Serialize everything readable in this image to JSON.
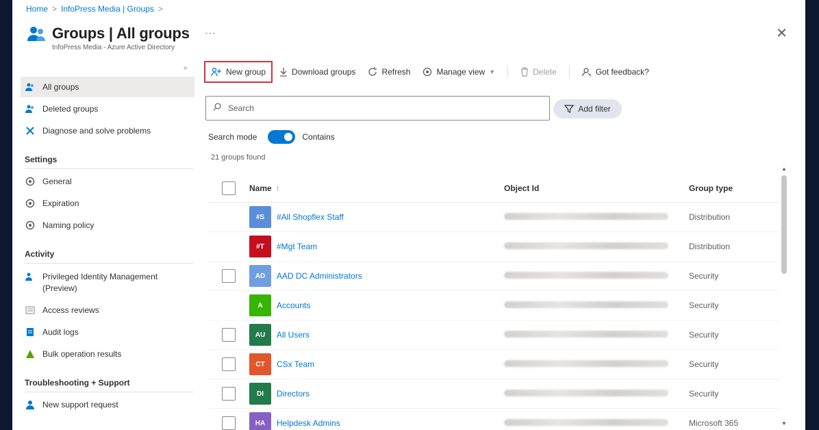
{
  "breadcrumb": {
    "home": "Home",
    "sep": ">",
    "tenant": "InfoPress Media | Groups"
  },
  "header": {
    "title": "Groups | All groups",
    "more": "···",
    "subtitle": "InfoPress Media - Azure Active Directory",
    "close": "✕"
  },
  "sidebar": {
    "collapse": "«",
    "items": [
      {
        "label": "All groups",
        "icon": "groups-icon"
      },
      {
        "label": "Deleted groups",
        "icon": "groups-icon"
      },
      {
        "label": "Diagnose and solve problems",
        "icon": "tools-icon"
      }
    ],
    "sections": [
      {
        "title": "Settings",
        "items": [
          {
            "label": "General",
            "icon": "gear-icon"
          },
          {
            "label": "Expiration",
            "icon": "gear-icon"
          },
          {
            "label": "Naming policy",
            "icon": "gear-icon"
          }
        ]
      },
      {
        "title": "Activity",
        "items": [
          {
            "label": "Privileged Identity Management (Preview)",
            "icon": "pim-icon"
          },
          {
            "label": "Access reviews",
            "icon": "list-icon"
          },
          {
            "label": "Audit logs",
            "icon": "log-icon"
          },
          {
            "label": "Bulk operation results",
            "icon": "bulk-icon"
          }
        ]
      },
      {
        "title": "Troubleshooting + Support",
        "items": [
          {
            "label": "New support request",
            "icon": "person-icon"
          }
        ]
      }
    ]
  },
  "toolbar": {
    "new_group": "New group",
    "download": "Download groups",
    "refresh": "Refresh",
    "manage_view": "Manage view",
    "delete": "Delete",
    "feedback": "Got feedback?"
  },
  "search": {
    "placeholder": "Search",
    "add_filter": "Add filter"
  },
  "mode": {
    "label": "Search mode",
    "value": "Contains"
  },
  "results": {
    "count": "21 groups found"
  },
  "table": {
    "headers": {
      "name": "Name",
      "sort": "↑",
      "object_id": "Object Id",
      "group_type": "Group type"
    },
    "rows": [
      {
        "initials": "#S",
        "color": "#5b8dd9",
        "name": "#All Shopflex Staff",
        "type": "Distribution",
        "checkbox": false
      },
      {
        "initials": "#T",
        "color": "#c50f1f",
        "name": "#Mgt Team",
        "type": "Distribution",
        "checkbox": false
      },
      {
        "initials": "AD",
        "color": "#6f9fe0",
        "name": "AAD DC Administrators",
        "type": "Security",
        "checkbox": true
      },
      {
        "initials": "A",
        "color": "#38b500",
        "name": "Accounts",
        "type": "Security",
        "checkbox": false
      },
      {
        "initials": "AU",
        "color": "#237b4b",
        "name": "All Users",
        "type": "Security",
        "checkbox": true
      },
      {
        "initials": "CT",
        "color": "#e1572b",
        "name": "CSx Team",
        "type": "Security",
        "checkbox": true
      },
      {
        "initials": "DI",
        "color": "#237b4b",
        "name": "Directors",
        "type": "Security",
        "checkbox": true
      },
      {
        "initials": "HA",
        "color": "#8661c5",
        "name": "Helpdesk Admins",
        "type": "Microsoft 365",
        "checkbox": true
      }
    ]
  },
  "scroll": {
    "up": "▲",
    "down": "▼"
  }
}
